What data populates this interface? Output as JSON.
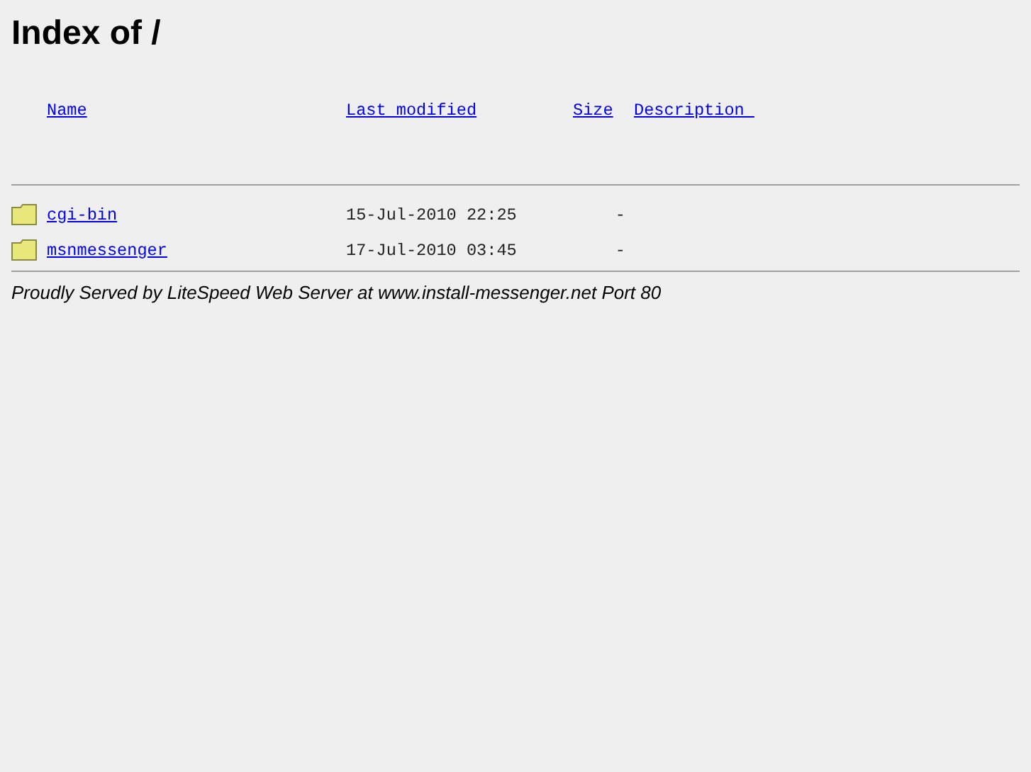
{
  "title": "Index of /",
  "columns": [
    "Name",
    "Last modified",
    "Size",
    "Description "
  ],
  "rows": [
    {
      "name": "cgi-bin",
      "modified": "15-Jul-2010 22:25",
      "size": "-"
    },
    {
      "name": "msnmessenger",
      "modified": "17-Jul-2010 03:45",
      "size": "-"
    }
  ],
  "footer": "Proudly Served by LiteSpeed Web Server at www.install-messenger.net Port 80"
}
